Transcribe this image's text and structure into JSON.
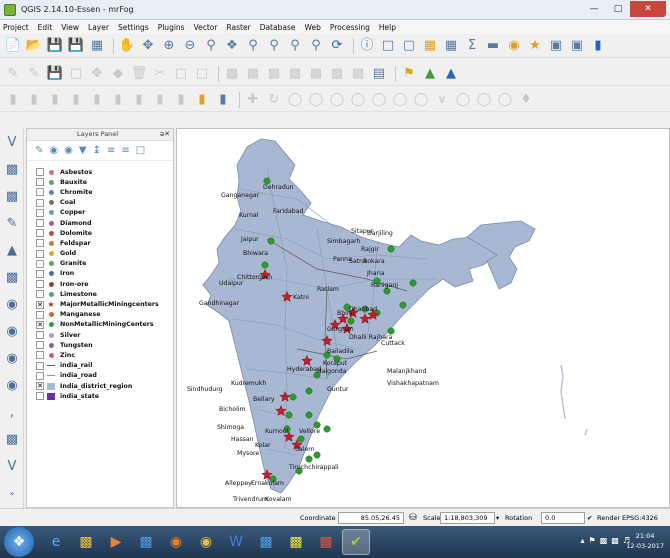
{
  "window": {
    "title": "QGIS 2.14.10-Essen - mrFog"
  },
  "menu": [
    "Project",
    "Edit",
    "View",
    "Layer",
    "Settings",
    "Plugins",
    "Vector",
    "Raster",
    "Database",
    "Web",
    "Processing",
    "Help"
  ],
  "layers_panel": {
    "title": "Layers Panel",
    "header_buttons": "ə✕",
    "layers": [
      {
        "name": "Asbestos",
        "checked": false,
        "color": "#d07080",
        "symbol": "dot"
      },
      {
        "name": "Bauxite",
        "checked": false,
        "color": "#5fa05f",
        "symbol": "dot"
      },
      {
        "name": "Chromite",
        "checked": false,
        "color": "#6080c0",
        "symbol": "dot"
      },
      {
        "name": "Coal",
        "checked": false,
        "color": "#707070",
        "symbol": "dot"
      },
      {
        "name": "Copper",
        "checked": false,
        "color": "#5aa0d0",
        "symbol": "dot"
      },
      {
        "name": "Diamond",
        "checked": false,
        "color": "#a060a0",
        "symbol": "dot"
      },
      {
        "name": "Dolomite",
        "checked": false,
        "color": "#b05050",
        "symbol": "dot"
      },
      {
        "name": "Feldspar",
        "checked": false,
        "color": "#c08040",
        "symbol": "dot"
      },
      {
        "name": "Gold",
        "checked": false,
        "color": "#d0b020",
        "symbol": "dot"
      },
      {
        "name": "Granite",
        "checked": false,
        "color": "#60a060",
        "symbol": "dot"
      },
      {
        "name": "Iron",
        "checked": false,
        "color": "#4070b0",
        "symbol": "dot"
      },
      {
        "name": "Iron-ore",
        "checked": false,
        "color": "#904040",
        "symbol": "dot"
      },
      {
        "name": "Limestone",
        "checked": false,
        "color": "#50a090",
        "symbol": "dot"
      },
      {
        "name": "MajorMetallicMiningcenters",
        "checked": true,
        "color": "#c0202a",
        "symbol": "star"
      },
      {
        "name": "Manganese",
        "checked": false,
        "color": "#c07030",
        "symbol": "dot"
      },
      {
        "name": "NonMetallicMiningCenters",
        "checked": true,
        "color": "#2e9a2e",
        "symbol": "dot"
      },
      {
        "name": "Silver",
        "checked": false,
        "color": "#a0a0c0",
        "symbol": "dot"
      },
      {
        "name": "Tungsten",
        "checked": false,
        "color": "#906090",
        "symbol": "dot"
      },
      {
        "name": "Zinc",
        "checked": false,
        "color": "#d06060",
        "symbol": "dot"
      },
      {
        "name": "india_rail",
        "checked": false,
        "color": "#606060",
        "symbol": "line"
      },
      {
        "name": "india_road",
        "checked": false,
        "color": "#909090",
        "symbol": "line"
      },
      {
        "name": "India_district_region",
        "checked": true,
        "color": "#a9b8d2",
        "symbol": "fill"
      },
      {
        "name": "india_state",
        "checked": false,
        "color": "#6a2fa0",
        "symbol": "fill"
      }
    ]
  },
  "map": {
    "fill_color": "#a9b8d2",
    "labels": [
      "Ganganagar",
      "Dehradun",
      "Kurnal",
      "Faridabad",
      "Darjiling",
      "Jaipur",
      "Bhiwara",
      "Udaipur",
      "Chittorgarh",
      "Simbagarh",
      "Panna",
      "Satna",
      "Sitapur",
      "Rajgir",
      "Bokara",
      "Jharia",
      "Raniganj",
      "Gandhinagar",
      "Ratlam",
      "Katni",
      "Bhilai",
      "Dhanbad",
      "Gurguan",
      "Dhalli Rajhara",
      "Cuttack",
      "Bailadila",
      "Koraput",
      "Malanjkhand",
      "Vishakhapatnam",
      "Hyderabad",
      "Nalgonda",
      "Sindhudurg",
      "Kudremukh",
      "Guntur",
      "Bellary",
      "Bicholim",
      "Shimoga",
      "Kurnool",
      "Vellore",
      "Hassan",
      "Kolar",
      "Salem",
      "Mysore",
      "Tiruchchirappali",
      "Alleppey",
      "Ernakulam",
      "Trivendrum",
      "Kovalam"
    ],
    "star_color": "#c0202a",
    "green_color": "#2e9a2e"
  },
  "status": {
    "coordinate_label": "Coordinate",
    "coordinate_value": "85.05,26.45",
    "scale_label": "Scale",
    "scale_value": "1:18,803,309",
    "rotation_label": "Rotation",
    "rotation_value": "0.0",
    "render_label": "Render",
    "crs": "EPSG:4326 (OTF)"
  },
  "taskbar": {
    "time": "21:04",
    "date": "12-03-2017"
  }
}
